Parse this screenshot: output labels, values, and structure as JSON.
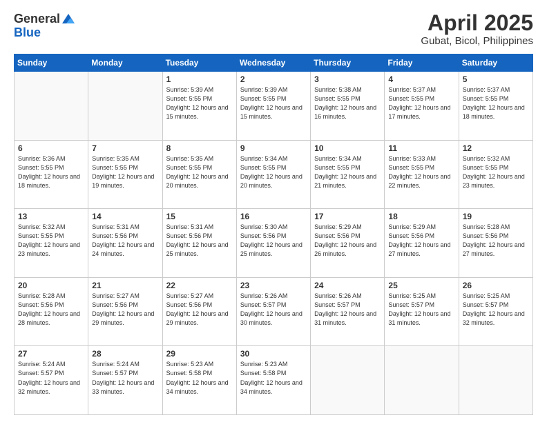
{
  "header": {
    "logo_general": "General",
    "logo_blue": "Blue",
    "title": "April 2025",
    "location": "Gubat, Bicol, Philippines"
  },
  "days_of_week": [
    "Sunday",
    "Monday",
    "Tuesday",
    "Wednesday",
    "Thursday",
    "Friday",
    "Saturday"
  ],
  "weeks": [
    [
      {
        "day": "",
        "sunrise": "",
        "sunset": "",
        "daylight": ""
      },
      {
        "day": "",
        "sunrise": "",
        "sunset": "",
        "daylight": ""
      },
      {
        "day": "1",
        "sunrise": "Sunrise: 5:39 AM",
        "sunset": "Sunset: 5:55 PM",
        "daylight": "Daylight: 12 hours and 15 minutes."
      },
      {
        "day": "2",
        "sunrise": "Sunrise: 5:39 AM",
        "sunset": "Sunset: 5:55 PM",
        "daylight": "Daylight: 12 hours and 15 minutes."
      },
      {
        "day": "3",
        "sunrise": "Sunrise: 5:38 AM",
        "sunset": "Sunset: 5:55 PM",
        "daylight": "Daylight: 12 hours and 16 minutes."
      },
      {
        "day": "4",
        "sunrise": "Sunrise: 5:37 AM",
        "sunset": "Sunset: 5:55 PM",
        "daylight": "Daylight: 12 hours and 17 minutes."
      },
      {
        "day": "5",
        "sunrise": "Sunrise: 5:37 AM",
        "sunset": "Sunset: 5:55 PM",
        "daylight": "Daylight: 12 hours and 18 minutes."
      }
    ],
    [
      {
        "day": "6",
        "sunrise": "Sunrise: 5:36 AM",
        "sunset": "Sunset: 5:55 PM",
        "daylight": "Daylight: 12 hours and 18 minutes."
      },
      {
        "day": "7",
        "sunrise": "Sunrise: 5:35 AM",
        "sunset": "Sunset: 5:55 PM",
        "daylight": "Daylight: 12 hours and 19 minutes."
      },
      {
        "day": "8",
        "sunrise": "Sunrise: 5:35 AM",
        "sunset": "Sunset: 5:55 PM",
        "daylight": "Daylight: 12 hours and 20 minutes."
      },
      {
        "day": "9",
        "sunrise": "Sunrise: 5:34 AM",
        "sunset": "Sunset: 5:55 PM",
        "daylight": "Daylight: 12 hours and 20 minutes."
      },
      {
        "day": "10",
        "sunrise": "Sunrise: 5:34 AM",
        "sunset": "Sunset: 5:55 PM",
        "daylight": "Daylight: 12 hours and 21 minutes."
      },
      {
        "day": "11",
        "sunrise": "Sunrise: 5:33 AM",
        "sunset": "Sunset: 5:55 PM",
        "daylight": "Daylight: 12 hours and 22 minutes."
      },
      {
        "day": "12",
        "sunrise": "Sunrise: 5:32 AM",
        "sunset": "Sunset: 5:55 PM",
        "daylight": "Daylight: 12 hours and 23 minutes."
      }
    ],
    [
      {
        "day": "13",
        "sunrise": "Sunrise: 5:32 AM",
        "sunset": "Sunset: 5:55 PM",
        "daylight": "Daylight: 12 hours and 23 minutes."
      },
      {
        "day": "14",
        "sunrise": "Sunrise: 5:31 AM",
        "sunset": "Sunset: 5:56 PM",
        "daylight": "Daylight: 12 hours and 24 minutes."
      },
      {
        "day": "15",
        "sunrise": "Sunrise: 5:31 AM",
        "sunset": "Sunset: 5:56 PM",
        "daylight": "Daylight: 12 hours and 25 minutes."
      },
      {
        "day": "16",
        "sunrise": "Sunrise: 5:30 AM",
        "sunset": "Sunset: 5:56 PM",
        "daylight": "Daylight: 12 hours and 25 minutes."
      },
      {
        "day": "17",
        "sunrise": "Sunrise: 5:29 AM",
        "sunset": "Sunset: 5:56 PM",
        "daylight": "Daylight: 12 hours and 26 minutes."
      },
      {
        "day": "18",
        "sunrise": "Sunrise: 5:29 AM",
        "sunset": "Sunset: 5:56 PM",
        "daylight": "Daylight: 12 hours and 27 minutes."
      },
      {
        "day": "19",
        "sunrise": "Sunrise: 5:28 AM",
        "sunset": "Sunset: 5:56 PM",
        "daylight": "Daylight: 12 hours and 27 minutes."
      }
    ],
    [
      {
        "day": "20",
        "sunrise": "Sunrise: 5:28 AM",
        "sunset": "Sunset: 5:56 PM",
        "daylight": "Daylight: 12 hours and 28 minutes."
      },
      {
        "day": "21",
        "sunrise": "Sunrise: 5:27 AM",
        "sunset": "Sunset: 5:56 PM",
        "daylight": "Daylight: 12 hours and 29 minutes."
      },
      {
        "day": "22",
        "sunrise": "Sunrise: 5:27 AM",
        "sunset": "Sunset: 5:56 PM",
        "daylight": "Daylight: 12 hours and 29 minutes."
      },
      {
        "day": "23",
        "sunrise": "Sunrise: 5:26 AM",
        "sunset": "Sunset: 5:57 PM",
        "daylight": "Daylight: 12 hours and 30 minutes."
      },
      {
        "day": "24",
        "sunrise": "Sunrise: 5:26 AM",
        "sunset": "Sunset: 5:57 PM",
        "daylight": "Daylight: 12 hours and 31 minutes."
      },
      {
        "day": "25",
        "sunrise": "Sunrise: 5:25 AM",
        "sunset": "Sunset: 5:57 PM",
        "daylight": "Daylight: 12 hours and 31 minutes."
      },
      {
        "day": "26",
        "sunrise": "Sunrise: 5:25 AM",
        "sunset": "Sunset: 5:57 PM",
        "daylight": "Daylight: 12 hours and 32 minutes."
      }
    ],
    [
      {
        "day": "27",
        "sunrise": "Sunrise: 5:24 AM",
        "sunset": "Sunset: 5:57 PM",
        "daylight": "Daylight: 12 hours and 32 minutes."
      },
      {
        "day": "28",
        "sunrise": "Sunrise: 5:24 AM",
        "sunset": "Sunset: 5:57 PM",
        "daylight": "Daylight: 12 hours and 33 minutes."
      },
      {
        "day": "29",
        "sunrise": "Sunrise: 5:23 AM",
        "sunset": "Sunset: 5:58 PM",
        "daylight": "Daylight: 12 hours and 34 minutes."
      },
      {
        "day": "30",
        "sunrise": "Sunrise: 5:23 AM",
        "sunset": "Sunset: 5:58 PM",
        "daylight": "Daylight: 12 hours and 34 minutes."
      },
      {
        "day": "",
        "sunrise": "",
        "sunset": "",
        "daylight": ""
      },
      {
        "day": "",
        "sunrise": "",
        "sunset": "",
        "daylight": ""
      },
      {
        "day": "",
        "sunrise": "",
        "sunset": "",
        "daylight": ""
      }
    ]
  ]
}
